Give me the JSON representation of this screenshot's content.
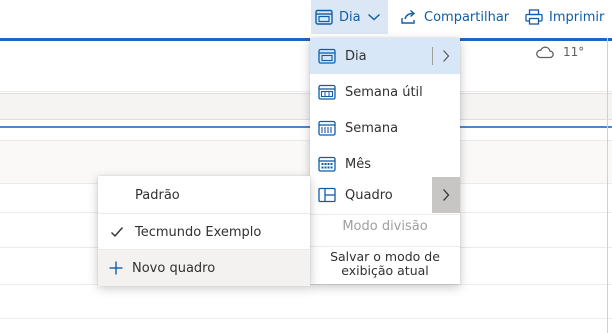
{
  "toolbar": {
    "view_label": "Dia",
    "share_label": "Compartilhar",
    "print_label": "Imprimir"
  },
  "weather": {
    "temperature": "11°"
  },
  "view_menu": {
    "items": [
      {
        "label": "Dia",
        "icon": "calendar-day-icon",
        "has_submenu": true,
        "selected": true
      },
      {
        "label": "Semana útil",
        "icon": "calendar-workweek-icon"
      },
      {
        "label": "Semana",
        "icon": "calendar-week-icon"
      },
      {
        "label": "Mês",
        "icon": "calendar-month-icon"
      },
      {
        "label": "Quadro",
        "icon": "board-icon",
        "has_submenu": true,
        "submenu_open": true
      }
    ],
    "split_mode_label": "Modo divisão",
    "save_view_label": "Salvar o modo de exibição atual"
  },
  "board_submenu": {
    "items": [
      {
        "label": "Padrão",
        "checked": false
      },
      {
        "label": "Tecmundo Exemplo",
        "checked": true
      }
    ],
    "new_board_label": "Novo quadro"
  },
  "colors": {
    "accent": "#0f5ea8",
    "selected_bg": "#d8e7f7",
    "divider_blue": "#1e66c0"
  }
}
